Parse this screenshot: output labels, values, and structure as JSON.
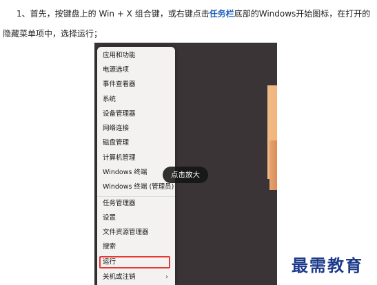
{
  "intro": {
    "part1": "1、首先，按键盘上的 Win + X 组合键，或右键点击",
    "link": "任务栏",
    "part2": "底部的Windows开始图标，在打开的隐藏菜单项中，选择运行；"
  },
  "menu": {
    "items": [
      "应用和功能",
      "电源选项",
      "事件查看器",
      "系统",
      "设备管理器",
      "网络连接",
      "磁盘管理",
      "计算机管理",
      "Windows 终端",
      "Windows 终端 (管理员)",
      "任务管理器",
      "设置",
      "文件资源管理器",
      "搜索",
      "运行",
      "关机或注销"
    ],
    "submenu_arrow": "›"
  },
  "zoom_label": "点击放大",
  "watermark": "最需教育",
  "colors": {
    "link": "#1f5fbf",
    "highlight_border": "#e53935",
    "watermark": "#1d3a8a"
  }
}
